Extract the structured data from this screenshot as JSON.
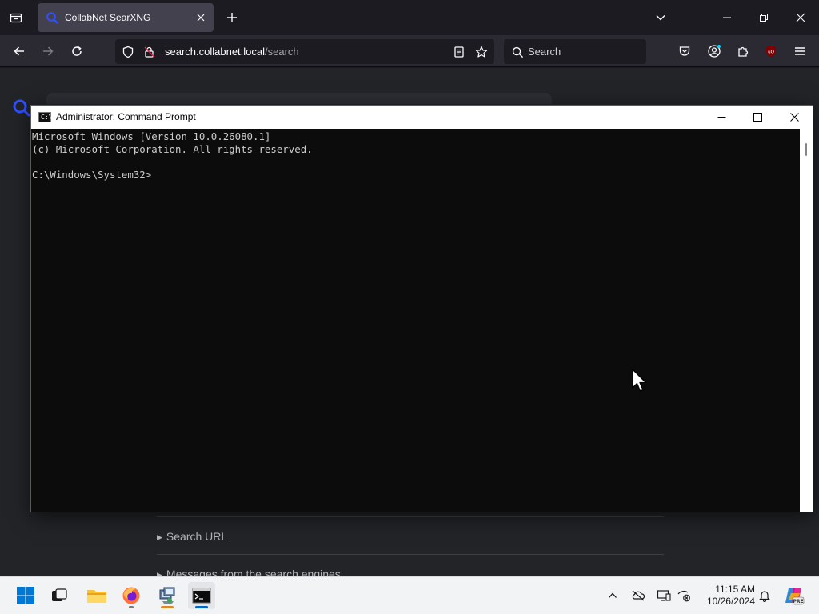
{
  "browser": {
    "tab": {
      "title": "CollabNet SearXNG"
    },
    "url": {
      "host": "search.collabnet.local",
      "path": "/search"
    },
    "search_placeholder": "Search"
  },
  "page": {
    "details": [
      {
        "label": "Search URL"
      },
      {
        "label": "Messages from the search engines"
      }
    ]
  },
  "cmd": {
    "title": "Administrator: Command Prompt",
    "icon_text": "C:\\",
    "lines": [
      "Microsoft Windows [Version 10.0.26080.1]",
      "(c) Microsoft Corporation. All rights reserved.",
      "",
      "C:\\Windows\\System32>"
    ]
  },
  "taskbar": {
    "time": "11:15 AM",
    "date": "10/26/2024",
    "pre_badge": "PRE",
    "apps": [
      "start-icon",
      "task-view-icon",
      "file-explorer-icon",
      "firefox-icon",
      "network-app-icon",
      "command-prompt-icon"
    ]
  },
  "colors": {
    "accent_blue": "#0067c0",
    "searxng_blue": "#3050ff",
    "terminal_bg": "#0c0c0c",
    "terminal_fg": "#cccccc"
  }
}
